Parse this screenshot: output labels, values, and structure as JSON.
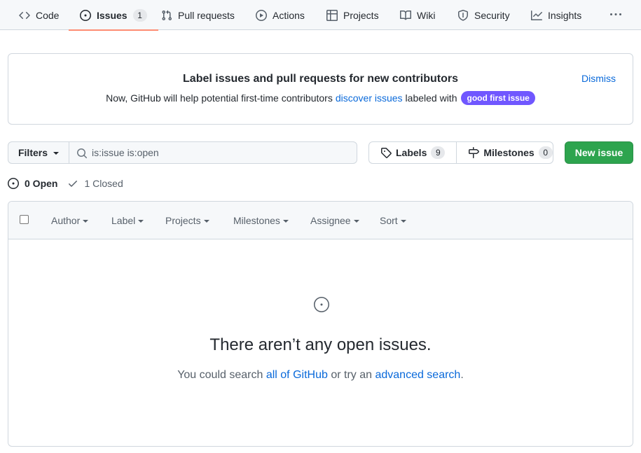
{
  "nav": {
    "items": [
      {
        "label": "Code",
        "icon": "code-icon"
      },
      {
        "label": "Issues",
        "icon": "issue-opened-icon",
        "count": "1",
        "selected": true
      },
      {
        "label": "Pull requests",
        "icon": "git-pull-request-icon"
      },
      {
        "label": "Actions",
        "icon": "play-icon"
      },
      {
        "label": "Projects",
        "icon": "table-icon"
      },
      {
        "label": "Wiki",
        "icon": "book-icon"
      },
      {
        "label": "Security",
        "icon": "shield-icon"
      },
      {
        "label": "Insights",
        "icon": "graph-icon"
      }
    ],
    "more_icon": "kebab-horizontal-icon"
  },
  "banner": {
    "title": "Label issues and pull requests for new contributors",
    "text_before": "Now, GitHub will help potential first-time contributors",
    "link": "discover issues",
    "text_after": "labeled with",
    "label": "good first issue",
    "label_color": "#7057ff",
    "dismiss": "Dismiss"
  },
  "toolbar": {
    "filters": "Filters",
    "search_value": "is:issue is:open",
    "labels": "Labels",
    "labels_count": "9",
    "milestones": "Milestones",
    "milestones_count": "0",
    "new_issue": "New issue",
    "new_issue_color": "#2da44e"
  },
  "states": {
    "open": "0 Open",
    "closed": "1 Closed"
  },
  "table_header": {
    "author": "Author",
    "label": "Label",
    "projects": "Projects",
    "milestones": "Milestones",
    "assignee": "Assignee",
    "sort": "Sort"
  },
  "blankslate": {
    "title": "There aren’t any open issues.",
    "text_before": "You could search",
    "link1": "all of GitHub",
    "text_middle": "or try an",
    "link2": "advanced search",
    "text_after": "."
  },
  "colors": {
    "accent": "#0969da",
    "selected_underline": "#fd8c73"
  }
}
